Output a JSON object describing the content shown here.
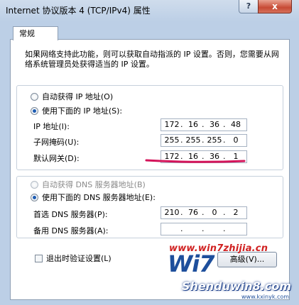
{
  "window": {
    "title": "Internet 协议版本 4 (TCP/IPv4) 属性",
    "help_label": "?",
    "close_label": "x"
  },
  "tabs": [
    {
      "label": "常规"
    }
  ],
  "description": "如果网络支持此功能，则可以获取自动指派的 IP 设置。否则，您需要从网络系统管理员处获得适当的 IP 设置。",
  "ip_section": {
    "auto_option": "自动获得 IP 地址(O)",
    "manual_option": "使用下面的 IP 地址(S):",
    "fields": [
      {
        "label": "IP 地址(I):",
        "octets": [
          "172",
          "16",
          "36",
          "48"
        ]
      },
      {
        "label": "子网掩码(U):",
        "octets": [
          "255",
          "255",
          "255",
          "0"
        ]
      },
      {
        "label": "默认网关(D):",
        "octets": [
          "172",
          "16",
          "36",
          "1"
        ]
      }
    ]
  },
  "dns_section": {
    "auto_option": "自动获得 DNS 服务器地址(B)",
    "manual_option": "使用下面的 DNS 服务器地址(E):",
    "fields": [
      {
        "label": "首选 DNS 服务器(P):",
        "octets": [
          "210",
          "76",
          "0",
          "2"
        ]
      },
      {
        "label": "备用 DNS 服务器(A):",
        "octets": [
          "",
          "",
          "",
          ""
        ]
      }
    ]
  },
  "validate_checkbox": "退出时验证设置(L)",
  "advanced_button": "高级(V)...",
  "watermark": {
    "url": "www.win7zhijia.cn",
    "brand": "Shenduwin8.com",
    "small": "www.kxinyk.com"
  },
  "colors": {
    "highlight_underline": "#d4145a",
    "accent": "#1d5cb2"
  }
}
